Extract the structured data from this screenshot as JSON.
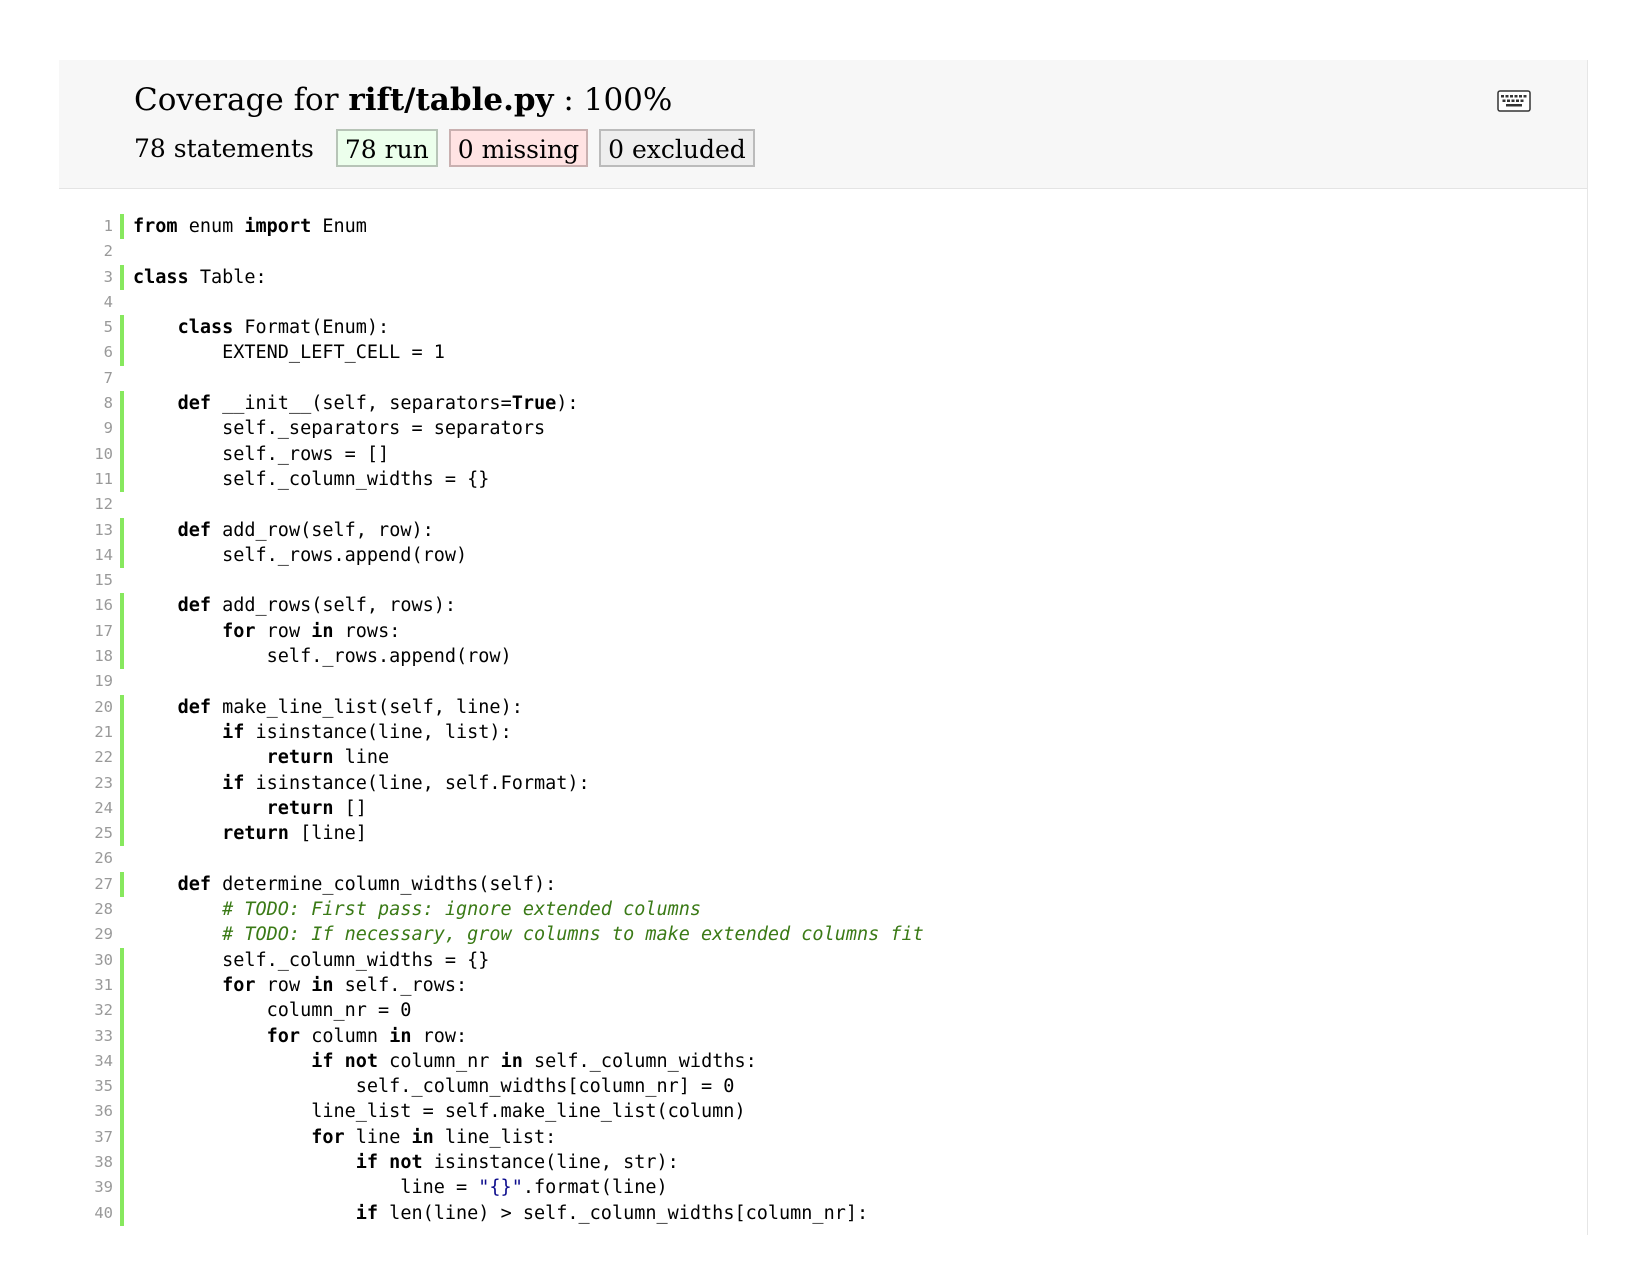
{
  "header": {
    "title_prefix": "Coverage for ",
    "file_name": "rift/table.py",
    "title_suffix": " : 100%",
    "statements": "78 statements",
    "run": "78 run",
    "missing": "0 missing",
    "excluded": "0 excluded",
    "keyboard_icon": "keyboard-icon"
  },
  "colors": {
    "run_marker": "#87e85e",
    "run_bg": "#ecffec",
    "missing_bg": "#ffe3e3",
    "excluded_bg": "#eeeeee",
    "comment": "#3a7a16",
    "string": "#0c0c8c"
  },
  "lines": [
    {
      "n": "1",
      "run": true,
      "tokens": [
        {
          "t": "kw",
          "v": "from"
        },
        {
          "t": "p",
          "v": " enum "
        },
        {
          "t": "kw",
          "v": "import"
        },
        {
          "t": "p",
          "v": " Enum"
        }
      ]
    },
    {
      "n": "2",
      "run": false,
      "tokens": []
    },
    {
      "n": "3",
      "run": true,
      "tokens": [
        {
          "t": "kw",
          "v": "class"
        },
        {
          "t": "p",
          "v": " Table:"
        }
      ]
    },
    {
      "n": "4",
      "run": false,
      "tokens": []
    },
    {
      "n": "5",
      "run": true,
      "tokens": [
        {
          "t": "p",
          "v": "    "
        },
        {
          "t": "kw",
          "v": "class"
        },
        {
          "t": "p",
          "v": " Format(Enum):"
        }
      ]
    },
    {
      "n": "6",
      "run": true,
      "tokens": [
        {
          "t": "p",
          "v": "        EXTEND_LEFT_CELL = 1"
        }
      ]
    },
    {
      "n": "7",
      "run": false,
      "tokens": []
    },
    {
      "n": "8",
      "run": true,
      "tokens": [
        {
          "t": "p",
          "v": "    "
        },
        {
          "t": "kw",
          "v": "def"
        },
        {
          "t": "p",
          "v": " __init__(self, separators="
        },
        {
          "t": "kw",
          "v": "True"
        },
        {
          "t": "p",
          "v": "):"
        }
      ]
    },
    {
      "n": "9",
      "run": true,
      "tokens": [
        {
          "t": "p",
          "v": "        self._separators = separators"
        }
      ]
    },
    {
      "n": "10",
      "run": true,
      "tokens": [
        {
          "t": "p",
          "v": "        self._rows = []"
        }
      ]
    },
    {
      "n": "11",
      "run": true,
      "tokens": [
        {
          "t": "p",
          "v": "        self._column_widths = {}"
        }
      ]
    },
    {
      "n": "12",
      "run": false,
      "tokens": []
    },
    {
      "n": "13",
      "run": true,
      "tokens": [
        {
          "t": "p",
          "v": "    "
        },
        {
          "t": "kw",
          "v": "def"
        },
        {
          "t": "p",
          "v": " add_row(self, row):"
        }
      ]
    },
    {
      "n": "14",
      "run": true,
      "tokens": [
        {
          "t": "p",
          "v": "        self._rows.append(row)"
        }
      ]
    },
    {
      "n": "15",
      "run": false,
      "tokens": []
    },
    {
      "n": "16",
      "run": true,
      "tokens": [
        {
          "t": "p",
          "v": "    "
        },
        {
          "t": "kw",
          "v": "def"
        },
        {
          "t": "p",
          "v": " add_rows(self, rows):"
        }
      ]
    },
    {
      "n": "17",
      "run": true,
      "tokens": [
        {
          "t": "p",
          "v": "        "
        },
        {
          "t": "kw",
          "v": "for"
        },
        {
          "t": "p",
          "v": " row "
        },
        {
          "t": "kw",
          "v": "in"
        },
        {
          "t": "p",
          "v": " rows:"
        }
      ]
    },
    {
      "n": "18",
      "run": true,
      "tokens": [
        {
          "t": "p",
          "v": "            self._rows.append(row)"
        }
      ]
    },
    {
      "n": "19",
      "run": false,
      "tokens": []
    },
    {
      "n": "20",
      "run": true,
      "tokens": [
        {
          "t": "p",
          "v": "    "
        },
        {
          "t": "kw",
          "v": "def"
        },
        {
          "t": "p",
          "v": " make_line_list(self, line):"
        }
      ]
    },
    {
      "n": "21",
      "run": true,
      "tokens": [
        {
          "t": "p",
          "v": "        "
        },
        {
          "t": "kw",
          "v": "if"
        },
        {
          "t": "p",
          "v": " isinstance(line, list):"
        }
      ]
    },
    {
      "n": "22",
      "run": true,
      "tokens": [
        {
          "t": "p",
          "v": "            "
        },
        {
          "t": "kw",
          "v": "return"
        },
        {
          "t": "p",
          "v": " line"
        }
      ]
    },
    {
      "n": "23",
      "run": true,
      "tokens": [
        {
          "t": "p",
          "v": "        "
        },
        {
          "t": "kw",
          "v": "if"
        },
        {
          "t": "p",
          "v": " isinstance(line, self.Format):"
        }
      ]
    },
    {
      "n": "24",
      "run": true,
      "tokens": [
        {
          "t": "p",
          "v": "            "
        },
        {
          "t": "kw",
          "v": "return"
        },
        {
          "t": "p",
          "v": " []"
        }
      ]
    },
    {
      "n": "25",
      "run": true,
      "tokens": [
        {
          "t": "p",
          "v": "        "
        },
        {
          "t": "kw",
          "v": "return"
        },
        {
          "t": "p",
          "v": " [line]"
        }
      ]
    },
    {
      "n": "26",
      "run": false,
      "tokens": []
    },
    {
      "n": "27",
      "run": true,
      "tokens": [
        {
          "t": "p",
          "v": "    "
        },
        {
          "t": "kw",
          "v": "def"
        },
        {
          "t": "p",
          "v": " determine_column_widths(self):"
        }
      ]
    },
    {
      "n": "28",
      "run": false,
      "tokens": [
        {
          "t": "p",
          "v": "        "
        },
        {
          "t": "com",
          "v": "# TODO: First pass: ignore extended columns"
        }
      ]
    },
    {
      "n": "29",
      "run": false,
      "tokens": [
        {
          "t": "p",
          "v": "        "
        },
        {
          "t": "com",
          "v": "# TODO: If necessary, grow columns to make extended columns fit"
        }
      ]
    },
    {
      "n": "30",
      "run": true,
      "tokens": [
        {
          "t": "p",
          "v": "        self._column_widths = {}"
        }
      ]
    },
    {
      "n": "31",
      "run": true,
      "tokens": [
        {
          "t": "p",
          "v": "        "
        },
        {
          "t": "kw",
          "v": "for"
        },
        {
          "t": "p",
          "v": " row "
        },
        {
          "t": "kw",
          "v": "in"
        },
        {
          "t": "p",
          "v": " self._rows:"
        }
      ]
    },
    {
      "n": "32",
      "run": true,
      "tokens": [
        {
          "t": "p",
          "v": "            column_nr = 0"
        }
      ]
    },
    {
      "n": "33",
      "run": true,
      "tokens": [
        {
          "t": "p",
          "v": "            "
        },
        {
          "t": "kw",
          "v": "for"
        },
        {
          "t": "p",
          "v": " column "
        },
        {
          "t": "kw",
          "v": "in"
        },
        {
          "t": "p",
          "v": " row:"
        }
      ]
    },
    {
      "n": "34",
      "run": true,
      "tokens": [
        {
          "t": "p",
          "v": "                "
        },
        {
          "t": "kw",
          "v": "if not"
        },
        {
          "t": "p",
          "v": " column_nr "
        },
        {
          "t": "kw",
          "v": "in"
        },
        {
          "t": "p",
          "v": " self._column_widths:"
        }
      ]
    },
    {
      "n": "35",
      "run": true,
      "tokens": [
        {
          "t": "p",
          "v": "                    self._column_widths[column_nr] = 0"
        }
      ]
    },
    {
      "n": "36",
      "run": true,
      "tokens": [
        {
          "t": "p",
          "v": "                line_list = self.make_line_list(column)"
        }
      ]
    },
    {
      "n": "37",
      "run": true,
      "tokens": [
        {
          "t": "p",
          "v": "                "
        },
        {
          "t": "kw",
          "v": "for"
        },
        {
          "t": "p",
          "v": " line "
        },
        {
          "t": "kw",
          "v": "in"
        },
        {
          "t": "p",
          "v": " line_list:"
        }
      ]
    },
    {
      "n": "38",
      "run": true,
      "tokens": [
        {
          "t": "p",
          "v": "                    "
        },
        {
          "t": "kw",
          "v": "if not"
        },
        {
          "t": "p",
          "v": " isinstance(line, str):"
        }
      ]
    },
    {
      "n": "39",
      "run": true,
      "tokens": [
        {
          "t": "p",
          "v": "                        line = "
        },
        {
          "t": "str",
          "v": "\"{}\""
        },
        {
          "t": "p",
          "v": ".format(line)"
        }
      ]
    },
    {
      "n": "40",
      "run": true,
      "tokens": [
        {
          "t": "p",
          "v": "                    "
        },
        {
          "t": "kw",
          "v": "if"
        },
        {
          "t": "p",
          "v": " len(line) > self._column_widths[column_nr]:"
        }
      ]
    }
  ]
}
